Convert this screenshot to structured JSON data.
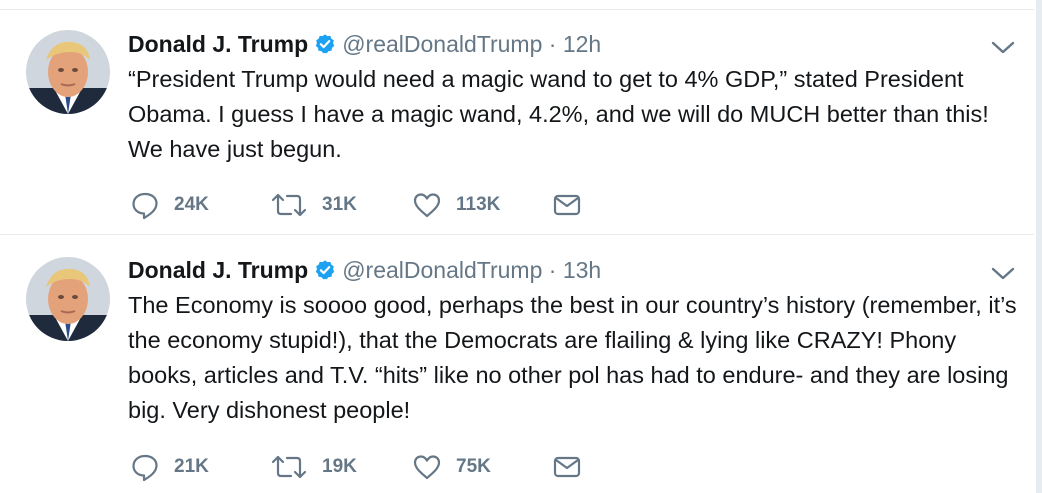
{
  "tweets": [
    {
      "name": "Donald J. Trump",
      "handle": "@realDonaldTrump",
      "time": "· 12h",
      "text": "“President Trump would need a magic wand to get to 4% GDP,” stated President Obama. I guess I have a magic wand, 4.2%, and we will do MUCH better than this! We have just begun.",
      "replies": "24K",
      "retweets": "31K",
      "likes": "113K"
    },
    {
      "name": "Donald J. Trump",
      "handle": "@realDonaldTrump",
      "time": "· 13h",
      "text": "The Economy is soooo good, perhaps the best in our country’s history (remember, it’s the economy stupid!), that the Democrats are flailing & lying like CRAZY! Phony books, articles and T.V. “hits” like no other pol has had to endure- and they are losing big. Very dishonest people!",
      "replies": "21K",
      "retweets": "19K",
      "likes": "75K"
    }
  ],
  "icons": {
    "reply": "speech-bubble-icon",
    "retweet": "retweet-arrows-icon",
    "like": "heart-icon",
    "dm": "envelope-icon",
    "verified": "verified-badge-icon",
    "more": "chevron-down-icon"
  },
  "colors": {
    "text": "#14171a",
    "secondary": "#657786",
    "verified": "#1da1f2",
    "divider": "#e6ecf0"
  }
}
